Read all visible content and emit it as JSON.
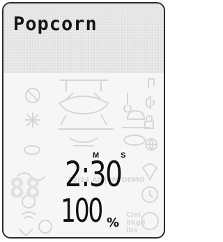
{
  "display": {
    "program_name": "Popcorn",
    "time": {
      "minutes_label": "M",
      "seconds_label": "S",
      "value": "2:30"
    },
    "power": {
      "value": "100",
      "unit": "%"
    }
  },
  "ghost_segments": {
    "clock_modes": "12|24 AM|PM DEMO",
    "weight_units": "Cini 8kg8 lbs",
    "digits": "88"
  },
  "icons": [
    "sound-wave-icon",
    "defrost-icon",
    "snowflake-icon",
    "oven-rack-icon",
    "dish-icon",
    "music-note-icon",
    "speaker-icon",
    "lock-icon",
    "globe-icon",
    "heart-icon",
    "clock-icon",
    "fan-icon",
    "wifi-icon",
    "bluetooth-icon"
  ],
  "colors": {
    "text": "#111111",
    "ghost": "#d8d8d8",
    "background": "#f6f6f6",
    "border": "#2a2a2a"
  }
}
